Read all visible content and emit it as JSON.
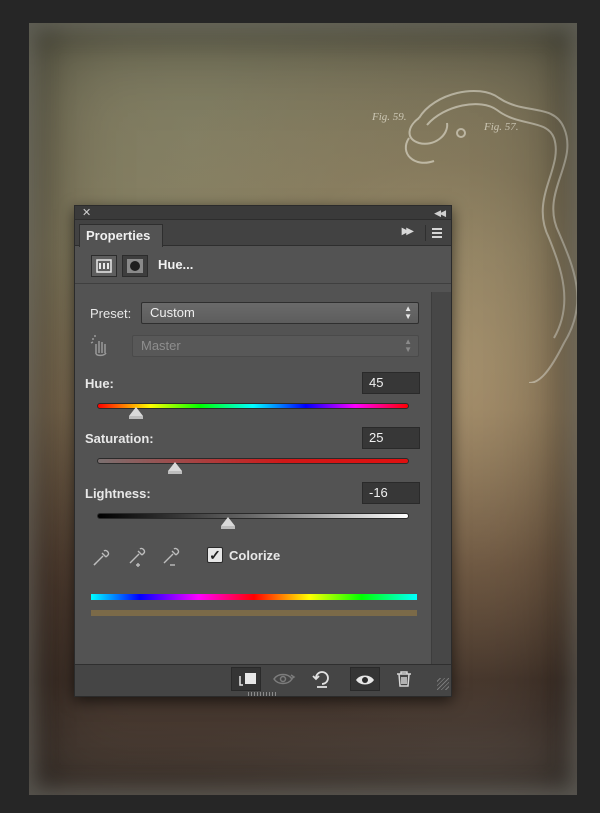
{
  "document": {
    "figure_labels": [
      "Fig. 59.",
      "Fig. 57."
    ]
  },
  "panel": {
    "tab_label": "Properties",
    "adjustment_title": "Hue...",
    "preset": {
      "label": "Preset:",
      "value": "Custom"
    },
    "range": {
      "value": "Master"
    },
    "hue": {
      "label": "Hue:",
      "value": "45",
      "level": 0.125
    },
    "saturation": {
      "label": "Saturation:",
      "value": "25",
      "level": 0.25
    },
    "lightness": {
      "label": "Lightness:",
      "value": "-16",
      "level": 0.42
    },
    "colorize": {
      "label": "Colorize",
      "checked": true
    },
    "colors": {
      "panel_bg": "#535353",
      "colorize_swatch": "#7b6a48"
    }
  },
  "icons": {
    "close": "close-icon",
    "collapse": "collapse-icon",
    "expand": "expand-icon",
    "panel_menu": "panel-menu-icon",
    "adjustment": "hue-saturation-icon",
    "mask": "mask-icon",
    "hand": "targeted-adjustment-hand-icon",
    "eyedroppers": [
      "eyedropper-icon",
      "eyedropper-add-icon",
      "eyedropper-subtract-icon"
    ],
    "footer": [
      "clip-to-layer-icon",
      "view-previous-state-icon",
      "reset-icon",
      "visibility-eye-icon",
      "trash-icon"
    ]
  }
}
